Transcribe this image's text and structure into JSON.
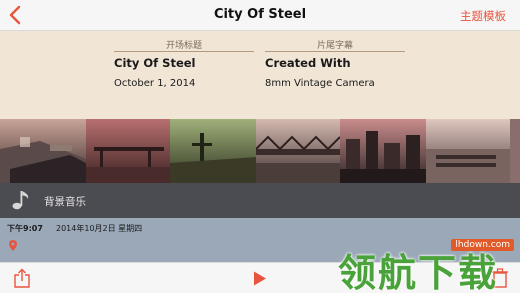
{
  "nav": {
    "title": "City Of Steel",
    "right_label": "主题模板",
    "accent_color": "#e8553e"
  },
  "titlecard": {
    "opening": {
      "header": "开场标题",
      "title": "City Of Steel",
      "subtitle": "October 1, 2014"
    },
    "ending": {
      "header": "片尾字幕",
      "title": "Created With",
      "subtitle": "8mm Vintage Camera"
    }
  },
  "filmstrip": {
    "frames": [
      "frame-1",
      "frame-2",
      "frame-3",
      "frame-4",
      "frame-5",
      "frame-6",
      "frame-7"
    ]
  },
  "music": {
    "icon": "music-note-icon",
    "label": "背景音乐"
  },
  "info": {
    "time": "下午9:07",
    "date": "2014年10月2日 星期四",
    "icon": "location-pin-icon"
  },
  "toolbar": {
    "share_icon": "share-icon",
    "play_icon": "play-icon",
    "right_icon": "trash-icon"
  },
  "watermark": {
    "url": "lhdown.com",
    "text": "领航下载"
  }
}
